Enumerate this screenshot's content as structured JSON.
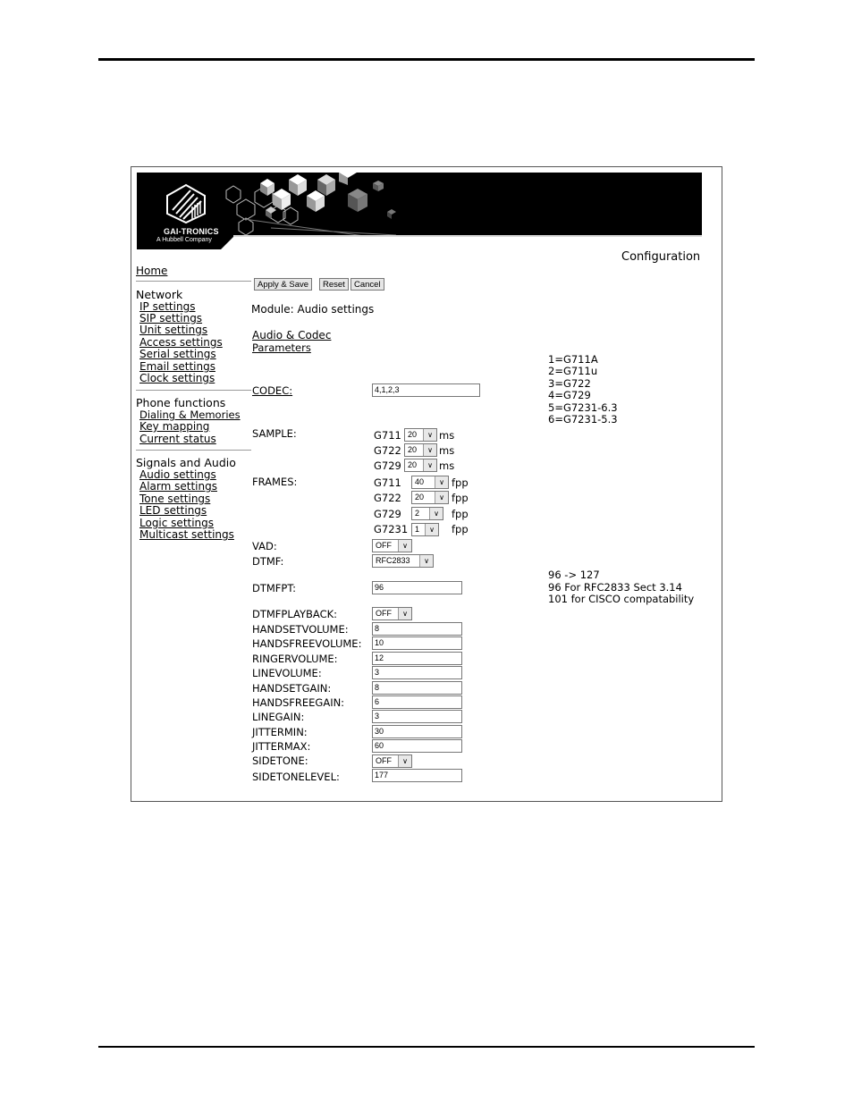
{
  "banner": {
    "logo_name": "GAI-TRONICS",
    "logo_sub": "A Hubbell Company"
  },
  "page_title": "Configuration",
  "sidebar": {
    "home": "Home",
    "network_head": "Network",
    "network_items": [
      "IP settings",
      "SIP settings",
      "Unit settings",
      "Access settings",
      "Serial settings",
      "Email settings",
      "Clock settings"
    ],
    "phone_head": "Phone functions",
    "phone_items": [
      "Dialing & Memories",
      "Key mapping",
      "Current status"
    ],
    "signals_head": "Signals and Audio",
    "signals_items": [
      "Audio settings",
      "Alarm settings",
      "Tone settings",
      "LED settings",
      "Logic settings",
      "Multicast settings"
    ]
  },
  "toolbar": {
    "apply": "Apply & Save",
    "reset": "Reset",
    "cancel": "Cancel"
  },
  "module_title": "Module: Audio settings",
  "section_link_1": "Audio & Codec",
  "section_link_2": "Parameters",
  "codec": {
    "label": "CODEC:",
    "value": "4,1,2,3"
  },
  "codec_notes": [
    "1=G711A",
    "2=G711u",
    "3=G722",
    "4=G729",
    "5=G7231-6.3",
    "6=G7231-5.3"
  ],
  "sample": {
    "label": "SAMPLE:",
    "unit": "ms",
    "rows": [
      {
        "codec": "G711",
        "value": "20"
      },
      {
        "codec": "G722",
        "value": "20"
      },
      {
        "codec": "G729",
        "value": "20"
      }
    ]
  },
  "frames": {
    "label": "FRAMES:",
    "unit": "fpp",
    "rows": [
      {
        "codec": "G711",
        "value": "40"
      },
      {
        "codec": "G722",
        "value": "20"
      },
      {
        "codec": "G729",
        "value": "2"
      },
      {
        "codec": "G7231",
        "value": "1"
      }
    ]
  },
  "vad": {
    "label": "VAD:",
    "value": "OFF"
  },
  "dtmf": {
    "label": "DTMF:",
    "value": "RFC2833"
  },
  "dtmfpt": {
    "label": "DTMFPT:",
    "value": "96"
  },
  "dtmfpt_notes": [
    "96 -> 127",
    "96 For RFC2833 Sect 3.14",
    "101 for CISCO compatability"
  ],
  "dtmfplayback": {
    "label": "DTMFPLAYBACK:",
    "value": "OFF"
  },
  "fields": [
    {
      "label": "HANDSETVOLUME:",
      "value": "8"
    },
    {
      "label": "HANDSFREEVOLUME:",
      "value": "10"
    },
    {
      "label": "RINGERVOLUME:",
      "value": "12"
    },
    {
      "label": "LINEVOLUME:",
      "value": "3"
    },
    {
      "label": "HANDSETGAIN:",
      "value": "8"
    },
    {
      "label": "HANDSFREEGAIN:",
      "value": "6"
    },
    {
      "label": "LINEGAIN:",
      "value": "3"
    },
    {
      "label": "JITTERMIN:",
      "value": "30"
    },
    {
      "label": "JITTERMAX:",
      "value": "60"
    }
  ],
  "sidetone": {
    "label": "SIDETONE:",
    "value": "OFF"
  },
  "sidetonelevel": {
    "label": "SIDETONELEVEL:",
    "value": "177"
  }
}
